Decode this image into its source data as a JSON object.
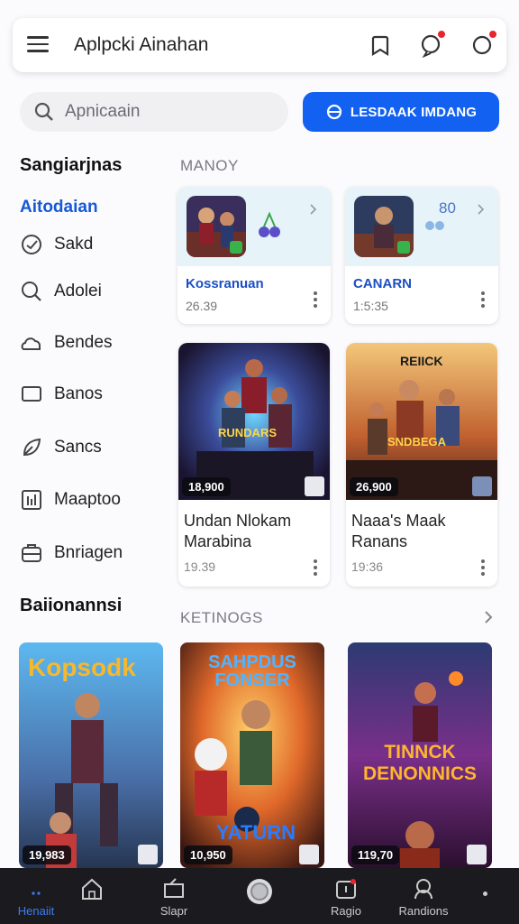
{
  "header": {
    "title": "Aplpcki Ainahan"
  },
  "search": {
    "placeholder": "Apnicaain",
    "cta_label": "LESDAAK IMDANG"
  },
  "sidebar": {
    "heading": "Sangiarjnas",
    "active_label": "Aitodaian",
    "items": [
      {
        "label": "Sakd",
        "icon": "check-circle-icon"
      },
      {
        "label": "Adolei",
        "icon": "search-icon"
      },
      {
        "label": "Bendes",
        "icon": "cloud-icon"
      },
      {
        "label": "Banos",
        "icon": "window-icon"
      },
      {
        "label": "Sancs",
        "icon": "leaf-icon"
      },
      {
        "label": "Maaptoo",
        "icon": "chart-icon"
      },
      {
        "label": "Bnriagen",
        "icon": "briefcase-icon"
      }
    ],
    "bottom_heading": "Baiionannsi"
  },
  "sections": {
    "top_label": "MANOY",
    "bottom_label": "KETINOGS"
  },
  "mini_cards": [
    {
      "name": "Kossranuan",
      "meta": "26.39",
      "counter": ""
    },
    {
      "name": "CANARN",
      "meta": "1:5:35",
      "counter": "80"
    }
  ],
  "game_cards": [
    {
      "title": "Undan Nlokam Marabina",
      "price": "18,900",
      "meta": "19.39",
      "art_text": "RUNDARS"
    },
    {
      "title": "Naaa's Maak Ranans",
      "price": "26,900",
      "meta": "19:36",
      "art_text": "SNDBEGA",
      "banner": "REIICK"
    }
  ],
  "posters": [
    {
      "title": "Kopsodk",
      "price": "19,983"
    },
    {
      "title": "SAHPDUS FONSER",
      "price": "10,950",
      "subtitle": "YATURN"
    },
    {
      "title": "TINNCK DENONNICS",
      "price": "119,70"
    }
  ],
  "nav": {
    "items": [
      {
        "label": "Henaiit"
      },
      {
        "label": "Slapr"
      },
      {
        "label": ""
      },
      {
        "label": "Ragio"
      },
      {
        "label": "Randions"
      }
    ]
  },
  "colors": {
    "accent": "#1361f0",
    "active_text": "#1658d6",
    "badge": "#e8242d",
    "nav_bg": "#1b1b1f"
  }
}
